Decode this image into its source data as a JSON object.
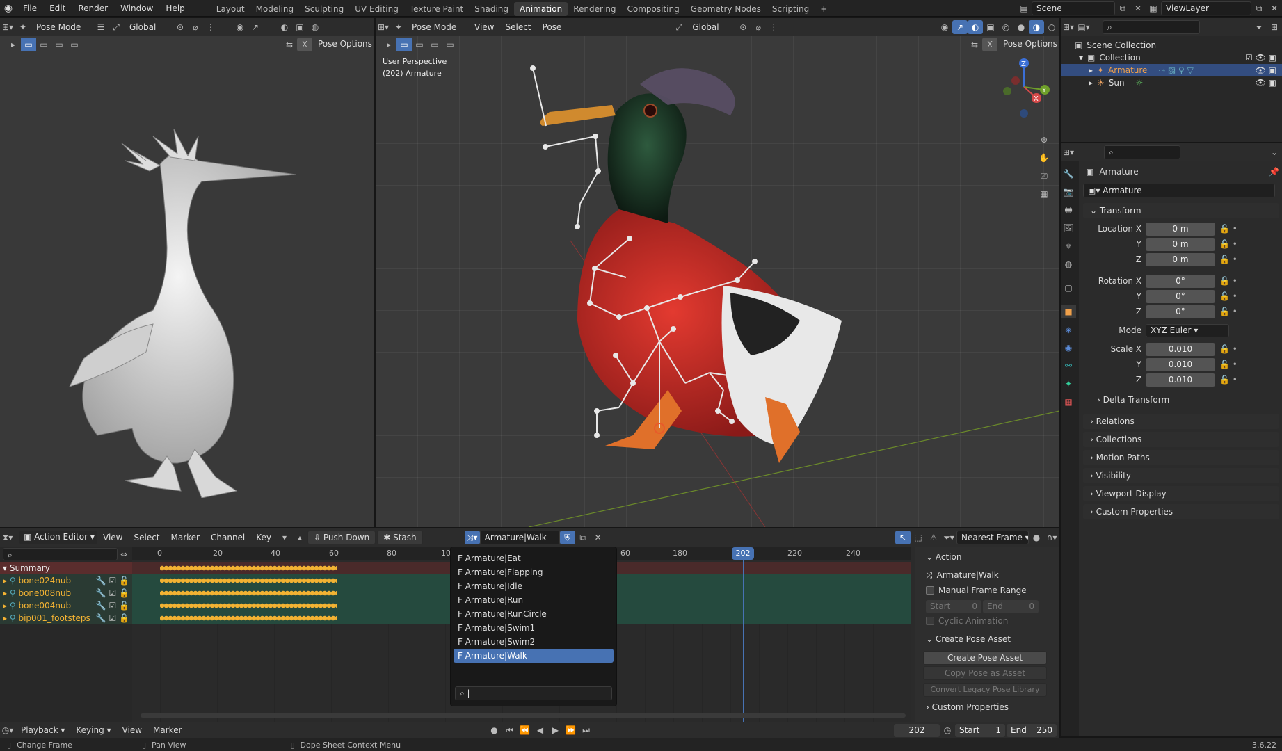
{
  "menu": {
    "file": "File",
    "edit": "Edit",
    "render": "Render",
    "window": "Window",
    "help": "Help"
  },
  "workspaces": [
    "Layout",
    "Modeling",
    "Sculpting",
    "UV Editing",
    "Texture Paint",
    "Shading",
    "Animation",
    "Rendering",
    "Compositing",
    "Geometry Nodes",
    "Scripting"
  ],
  "active_workspace": "Animation",
  "plus": "+",
  "scene": {
    "name": "Scene",
    "view_layer": "ViewLayer"
  },
  "left_vp": {
    "mode": "Pose Mode",
    "orientation": "Global",
    "pose_options": "Pose Options"
  },
  "main_vp": {
    "mode": "Pose Mode",
    "menus": [
      "View",
      "Select",
      "Pose"
    ],
    "orientation": "Global",
    "pose_options": "Pose Options",
    "overlay_line1": "User Perspective",
    "overlay_line2": "(202) Armature",
    "gizmo": {
      "z": "Z",
      "y": "Y",
      "x": "X"
    }
  },
  "outliner": {
    "root": "Scene Collection",
    "collection": "Collection",
    "items": [
      {
        "name": "Armature",
        "selected": true
      },
      {
        "name": "Sun",
        "selected": false
      }
    ]
  },
  "properties": {
    "object": "Armature",
    "data_name": "Armature",
    "transform": "Transform",
    "location_label": "Location X",
    "location": [
      "0 m",
      "0 m",
      "0 m"
    ],
    "rotation_label": "Rotation X",
    "rotation": [
      "0°",
      "0°",
      "0°"
    ],
    "mode_label": "Mode",
    "mode": "XYZ Euler",
    "scale_label": "Scale X",
    "scale": [
      "0.010",
      "0.010",
      "0.010"
    ],
    "y": "Y",
    "z": "Z",
    "delta": "Delta Transform",
    "sections": [
      "Relations",
      "Collections",
      "Motion Paths",
      "Visibility",
      "Viewport Display",
      "Custom Properties"
    ]
  },
  "action_editor": {
    "type": "Action Editor",
    "menus": [
      "View",
      "Select",
      "Marker",
      "Channel",
      "Key"
    ],
    "push_down": "Push Down",
    "stash": "Stash",
    "action": "Armature|Walk",
    "snap": "Nearest Frame"
  },
  "timeline_ticks": [
    "0",
    "20",
    "40",
    "60",
    "80",
    "10",
    "60",
    "180",
    "220",
    "240"
  ],
  "current_frame": "202",
  "channels": [
    "Summary",
    "bone024nub",
    "bone008nub",
    "bone004nub",
    "bip001_footsteps"
  ],
  "action_menu": {
    "items": [
      "F Armature|Eat",
      "F Armature|Flapping",
      "F Armature|Idle",
      "F Armature|Run",
      "F Armature|RunCircle",
      "F Armature|Swim1",
      "F Armature|Swim2",
      "F Armature|Walk"
    ],
    "selected": "F Armature|Walk"
  },
  "side_panel": {
    "action_header": "Action",
    "action_name": "Armature|Walk",
    "manual_range": "Manual Frame Range",
    "start_label": "Start",
    "start": "0",
    "end_label": "End",
    "end": "0",
    "cyclic": "Cyclic Animation",
    "pose_header": "Create Pose Asset",
    "create_pose": "Create Pose Asset",
    "copy_pose": "Copy Pose as Asset",
    "convert": "Convert Legacy Pose Library",
    "custom_props": "Custom Properties"
  },
  "playback": {
    "menus": [
      "Playback",
      "Keying",
      "View",
      "Marker"
    ],
    "frame": "202",
    "start_label": "Start",
    "start": "1",
    "end_label": "End",
    "end": "250"
  },
  "status": {
    "left": "Change Frame",
    "mid": "Pan View",
    "right": "Dope Sheet Context Menu",
    "version": "3.6.22"
  },
  "colors": {
    "accent": "#4772b3",
    "keyframe": "#f2b233",
    "channel_bg": "#2b5a4a",
    "summary_bg": "#5a2d2d",
    "playhead": "#4772b3"
  }
}
